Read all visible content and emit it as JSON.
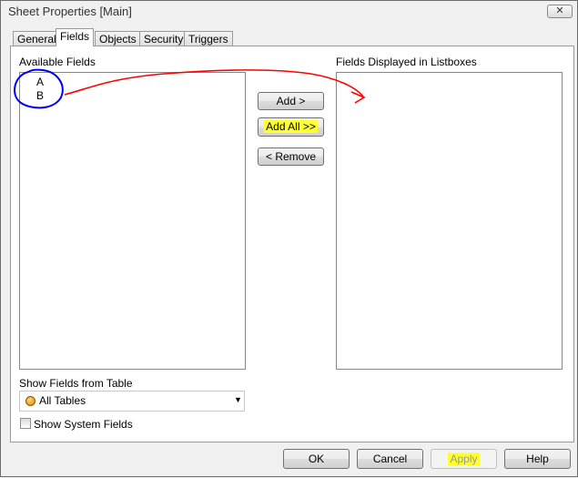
{
  "window": {
    "title": "Sheet Properties [Main]",
    "close_glyph": "✕"
  },
  "tabs": [
    {
      "label": "General"
    },
    {
      "label": "Fields",
      "active": true
    },
    {
      "label": "Objects"
    },
    {
      "label": "Security"
    },
    {
      "label": "Triggers"
    }
  ],
  "fields": {
    "available_label": "Available Fields",
    "available_items": [
      "A",
      "B"
    ],
    "displayed_label": "Fields Displayed in Listboxes",
    "displayed_items": [],
    "add_label": "Add >",
    "add_all_label": "Add All >>",
    "remove_label": "< Remove",
    "show_from_table_label": "Show Fields from Table",
    "table_select_value": "All Tables",
    "show_system_fields_label": "Show System Fields",
    "show_system_fields_checked": false
  },
  "footer": {
    "ok": "OK",
    "cancel": "Cancel",
    "apply": "Apply",
    "help": "Help"
  },
  "annotations": {
    "circle_color": "#0000ff",
    "arrow_color": "#ff0000",
    "highlight_color": "#ffff33"
  }
}
